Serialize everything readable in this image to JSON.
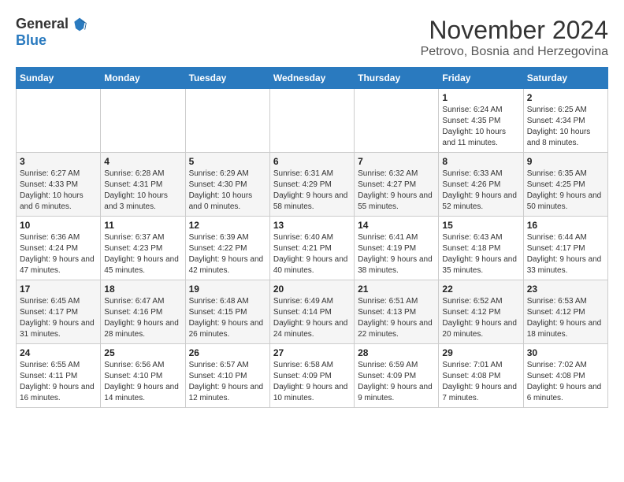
{
  "logo": {
    "general": "General",
    "blue": "Blue",
    "tagline": "GeneralBlue"
  },
  "header": {
    "month_year": "November 2024",
    "location": "Petrovo, Bosnia and Herzegovina"
  },
  "weekdays": [
    "Sunday",
    "Monday",
    "Tuesday",
    "Wednesday",
    "Thursday",
    "Friday",
    "Saturday"
  ],
  "weeks": [
    [
      {
        "day": "",
        "info": ""
      },
      {
        "day": "",
        "info": ""
      },
      {
        "day": "",
        "info": ""
      },
      {
        "day": "",
        "info": ""
      },
      {
        "day": "",
        "info": ""
      },
      {
        "day": "1",
        "info": "Sunrise: 6:24 AM\nSunset: 4:35 PM\nDaylight: 10 hours and 11 minutes."
      },
      {
        "day": "2",
        "info": "Sunrise: 6:25 AM\nSunset: 4:34 PM\nDaylight: 10 hours and 8 minutes."
      }
    ],
    [
      {
        "day": "3",
        "info": "Sunrise: 6:27 AM\nSunset: 4:33 PM\nDaylight: 10 hours and 6 minutes."
      },
      {
        "day": "4",
        "info": "Sunrise: 6:28 AM\nSunset: 4:31 PM\nDaylight: 10 hours and 3 minutes."
      },
      {
        "day": "5",
        "info": "Sunrise: 6:29 AM\nSunset: 4:30 PM\nDaylight: 10 hours and 0 minutes."
      },
      {
        "day": "6",
        "info": "Sunrise: 6:31 AM\nSunset: 4:29 PM\nDaylight: 9 hours and 58 minutes."
      },
      {
        "day": "7",
        "info": "Sunrise: 6:32 AM\nSunset: 4:27 PM\nDaylight: 9 hours and 55 minutes."
      },
      {
        "day": "8",
        "info": "Sunrise: 6:33 AM\nSunset: 4:26 PM\nDaylight: 9 hours and 52 minutes."
      },
      {
        "day": "9",
        "info": "Sunrise: 6:35 AM\nSunset: 4:25 PM\nDaylight: 9 hours and 50 minutes."
      }
    ],
    [
      {
        "day": "10",
        "info": "Sunrise: 6:36 AM\nSunset: 4:24 PM\nDaylight: 9 hours and 47 minutes."
      },
      {
        "day": "11",
        "info": "Sunrise: 6:37 AM\nSunset: 4:23 PM\nDaylight: 9 hours and 45 minutes."
      },
      {
        "day": "12",
        "info": "Sunrise: 6:39 AM\nSunset: 4:22 PM\nDaylight: 9 hours and 42 minutes."
      },
      {
        "day": "13",
        "info": "Sunrise: 6:40 AM\nSunset: 4:21 PM\nDaylight: 9 hours and 40 minutes."
      },
      {
        "day": "14",
        "info": "Sunrise: 6:41 AM\nSunset: 4:19 PM\nDaylight: 9 hours and 38 minutes."
      },
      {
        "day": "15",
        "info": "Sunrise: 6:43 AM\nSunset: 4:18 PM\nDaylight: 9 hours and 35 minutes."
      },
      {
        "day": "16",
        "info": "Sunrise: 6:44 AM\nSunset: 4:17 PM\nDaylight: 9 hours and 33 minutes."
      }
    ],
    [
      {
        "day": "17",
        "info": "Sunrise: 6:45 AM\nSunset: 4:17 PM\nDaylight: 9 hours and 31 minutes."
      },
      {
        "day": "18",
        "info": "Sunrise: 6:47 AM\nSunset: 4:16 PM\nDaylight: 9 hours and 28 minutes."
      },
      {
        "day": "19",
        "info": "Sunrise: 6:48 AM\nSunset: 4:15 PM\nDaylight: 9 hours and 26 minutes."
      },
      {
        "day": "20",
        "info": "Sunrise: 6:49 AM\nSunset: 4:14 PM\nDaylight: 9 hours and 24 minutes."
      },
      {
        "day": "21",
        "info": "Sunrise: 6:51 AM\nSunset: 4:13 PM\nDaylight: 9 hours and 22 minutes."
      },
      {
        "day": "22",
        "info": "Sunrise: 6:52 AM\nSunset: 4:12 PM\nDaylight: 9 hours and 20 minutes."
      },
      {
        "day": "23",
        "info": "Sunrise: 6:53 AM\nSunset: 4:12 PM\nDaylight: 9 hours and 18 minutes."
      }
    ],
    [
      {
        "day": "24",
        "info": "Sunrise: 6:55 AM\nSunset: 4:11 PM\nDaylight: 9 hours and 16 minutes."
      },
      {
        "day": "25",
        "info": "Sunrise: 6:56 AM\nSunset: 4:10 PM\nDaylight: 9 hours and 14 minutes."
      },
      {
        "day": "26",
        "info": "Sunrise: 6:57 AM\nSunset: 4:10 PM\nDaylight: 9 hours and 12 minutes."
      },
      {
        "day": "27",
        "info": "Sunrise: 6:58 AM\nSunset: 4:09 PM\nDaylight: 9 hours and 10 minutes."
      },
      {
        "day": "28",
        "info": "Sunrise: 6:59 AM\nSunset: 4:09 PM\nDaylight: 9 hours and 9 minutes."
      },
      {
        "day": "29",
        "info": "Sunrise: 7:01 AM\nSunset: 4:08 PM\nDaylight: 9 hours and 7 minutes."
      },
      {
        "day": "30",
        "info": "Sunrise: 7:02 AM\nSunset: 4:08 PM\nDaylight: 9 hours and 6 minutes."
      }
    ]
  ]
}
